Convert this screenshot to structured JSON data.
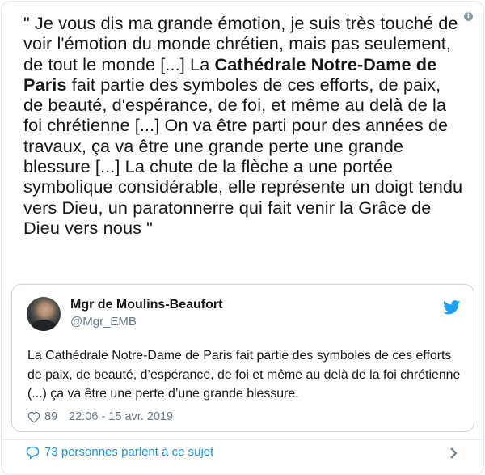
{
  "quote": {
    "part1": "\" Je vous dis ma grande émotion, je suis très touché de voir l'émotion du monde chrétien, mais pas seulement, de tout le monde [...] La ",
    "bold": "Cathédrale Notre-Dame de Paris",
    "part2": " fait partie des symboles de ces efforts, de paix, de beauté, d'espérance, de foi, et même au delà de la foi chrétienne [...] On va être parti pour des années de travaux, ça va être une grande perte une grande blessure [...] La chute de la flèche a une portée symbolique considérable, elle représente un doigt tendu vers Dieu, un paratonnerre qui fait venir la Grâce de Dieu vers nous \""
  },
  "info_icon_glyph": "i",
  "tweet": {
    "author_name": "Mgr de Moulins-Beaufort",
    "handle": "@Mgr_EMB",
    "text": "La Cathédrale Notre-Dame de Paris fait partie des symboles de ces efforts de paix, de beauté, d’espérance, de foi et même au delà de la foi chrétienne (...) ça va être une perte d’une grande blessure.",
    "likes": "89",
    "timestamp": "22:06 - 15 avr. 2019"
  },
  "conversation_label": "73 personnes parlent à ce sujet",
  "icons": [
    "info-icon",
    "avatar",
    "twitter-bird-icon",
    "heart-icon",
    "speech-bubble-icon",
    "chevron-right-icon"
  ],
  "colors": {
    "twitter_blue": "#1da1f2",
    "link_blue": "#1b95e0",
    "muted": "#657786"
  }
}
